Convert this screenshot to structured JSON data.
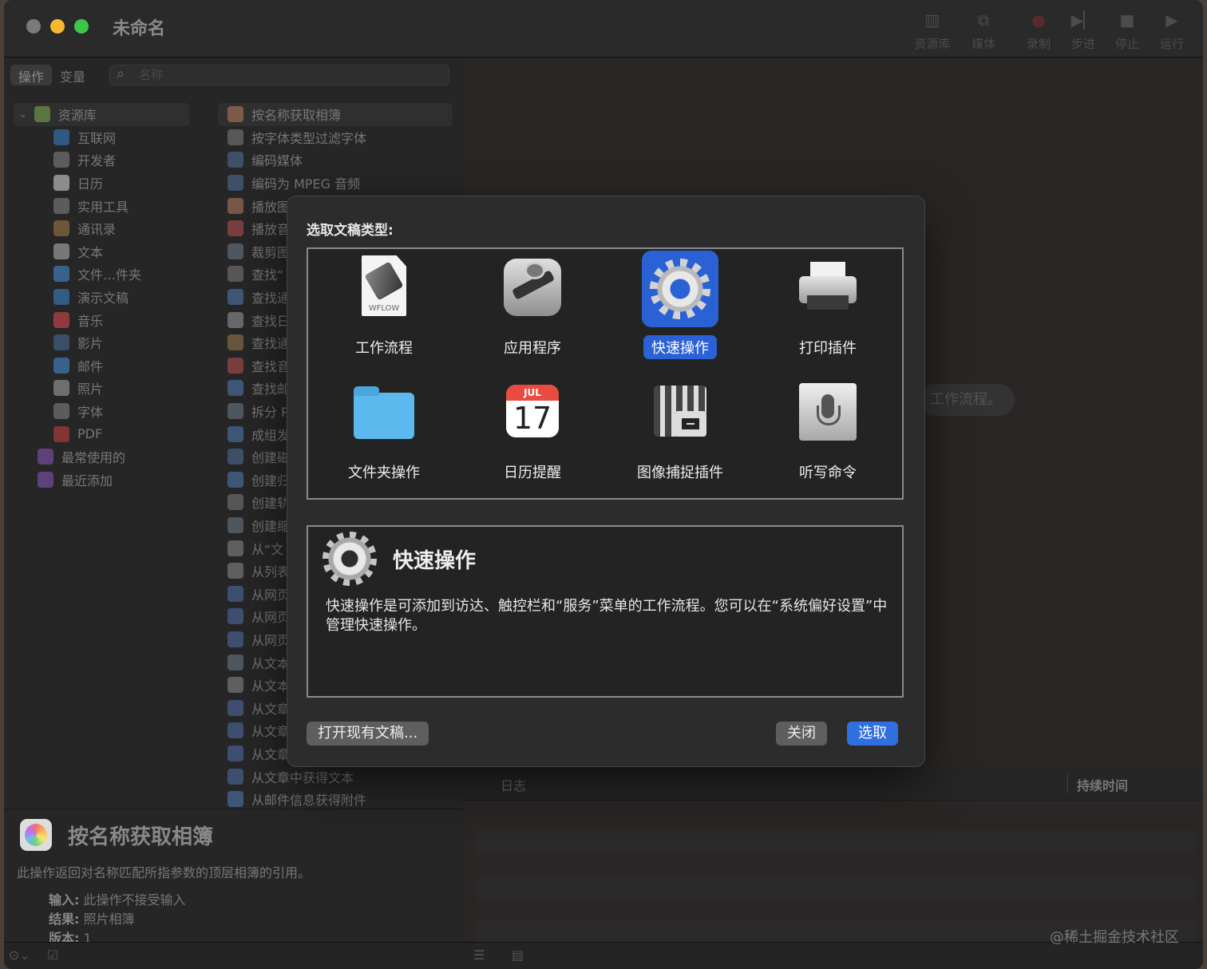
{
  "window": {
    "title": "未命名"
  },
  "toolbar": {
    "library": "资源库",
    "media": "媒体",
    "record": "录制",
    "step": "步进",
    "stop": "停止",
    "run": "运行"
  },
  "leftpanel": {
    "tab_actions": "操作",
    "tab_variables": "变量",
    "search_placeholder": "名称",
    "library": [
      {
        "label": "资源库",
        "icon": "library-icon",
        "color": "#7bb04a"
      },
      {
        "label": "互联网",
        "icon": "globe-icon",
        "color": "#3a7fd0"
      },
      {
        "label": "开发者",
        "icon": "tools-icon",
        "color": "#888888"
      },
      {
        "label": "日历",
        "icon": "calendar-icon",
        "color": "#e0e0e0"
      },
      {
        "label": "实用工具",
        "icon": "tools-icon",
        "color": "#888888"
      },
      {
        "label": "通讯录",
        "icon": "contacts-icon",
        "color": "#a87d4a"
      },
      {
        "label": "文本",
        "icon": "text-icon",
        "color": "#bbbbbb"
      },
      {
        "label": "文件…件夹",
        "icon": "finder-icon",
        "color": "#4a90e0"
      },
      {
        "label": "演示文稿",
        "icon": "keynote-icon",
        "color": "#3a8ad0"
      },
      {
        "label": "音乐",
        "icon": "music-icon",
        "color": "#e84b55"
      },
      {
        "label": "影片",
        "icon": "movie-icon",
        "color": "#4a70a0"
      },
      {
        "label": "邮件",
        "icon": "mail-icon",
        "color": "#4a90e0"
      },
      {
        "label": "照片",
        "icon": "photo-icon",
        "color": "#aaaaaa"
      },
      {
        "label": "字体",
        "icon": "font-icon",
        "color": "#888888"
      },
      {
        "label": "PDF",
        "icon": "pdf-icon",
        "color": "#d04040"
      },
      {
        "label": "最常使用的",
        "icon": "folder-icon",
        "color": "#8a5ac0"
      },
      {
        "label": "最近添加",
        "icon": "folder-icon",
        "color": "#8a5ac0"
      }
    ],
    "actions": [
      "按名称获取相簿",
      "按字体类型过滤字体",
      "编码媒体",
      "编码为 MPEG 音频",
      "播放图",
      "播放音",
      "裁剪图",
      "查找“",
      "查找通",
      "查找日",
      "查找通",
      "查找音",
      "查找邮",
      "拆分 P",
      "成组发",
      "创建磁",
      "创建归",
      "创建轨",
      "创建缩",
      "从“文",
      "从列表",
      "从网页",
      "从网页",
      "从网页",
      "从文本",
      "从文本",
      "从文章",
      "从文章",
      "从文章",
      "从文章中获得文本",
      "从邮件信息获得附件"
    ],
    "description": {
      "title": "按名称获取相簿",
      "text": "此操作返回对名称匹配所指参数的顶层相簿的引用。",
      "input_label": "输入:",
      "input_value": "此操作不接受输入",
      "result_label": "结果:",
      "result_value": "照片相簿",
      "version_label": "版本:",
      "version_value": "1"
    }
  },
  "rightarea": {
    "ghost_text": "工作流程。",
    "log_col": "日志",
    "duration_col": "持续时间"
  },
  "watermark": "@稀土掘金技术社区",
  "modal": {
    "title": "选取文稿类型:",
    "types": [
      {
        "label": "工作流程",
        "icon": "workflow-doc-icon",
        "selected": false,
        "badge": "WFLOW"
      },
      {
        "label": "应用程序",
        "icon": "automator-robot-icon",
        "selected": false
      },
      {
        "label": "快速操作",
        "icon": "gear-icon",
        "selected": true
      },
      {
        "label": "打印插件",
        "icon": "printer-icon",
        "selected": false
      },
      {
        "label": "文件夹操作",
        "icon": "folder-icon",
        "selected": false
      },
      {
        "label": "日历提醒",
        "icon": "calendar-icon",
        "selected": false,
        "month": "JUL",
        "day": "17"
      },
      {
        "label": "图像捕捉插件",
        "icon": "image-capture-icon",
        "selected": false
      },
      {
        "label": "听写命令",
        "icon": "microphone-icon",
        "selected": false
      }
    ],
    "info_title": "快速操作",
    "info_text": "快速操作是可添加到访达、触控栏和“服务”菜单的工作流程。您可以在“系统偏好设置”中管理快速操作。",
    "btn_open": "打开现有文稿...",
    "btn_close": "关闭",
    "btn_select": "选取",
    "accent": "#2f6fe0"
  }
}
